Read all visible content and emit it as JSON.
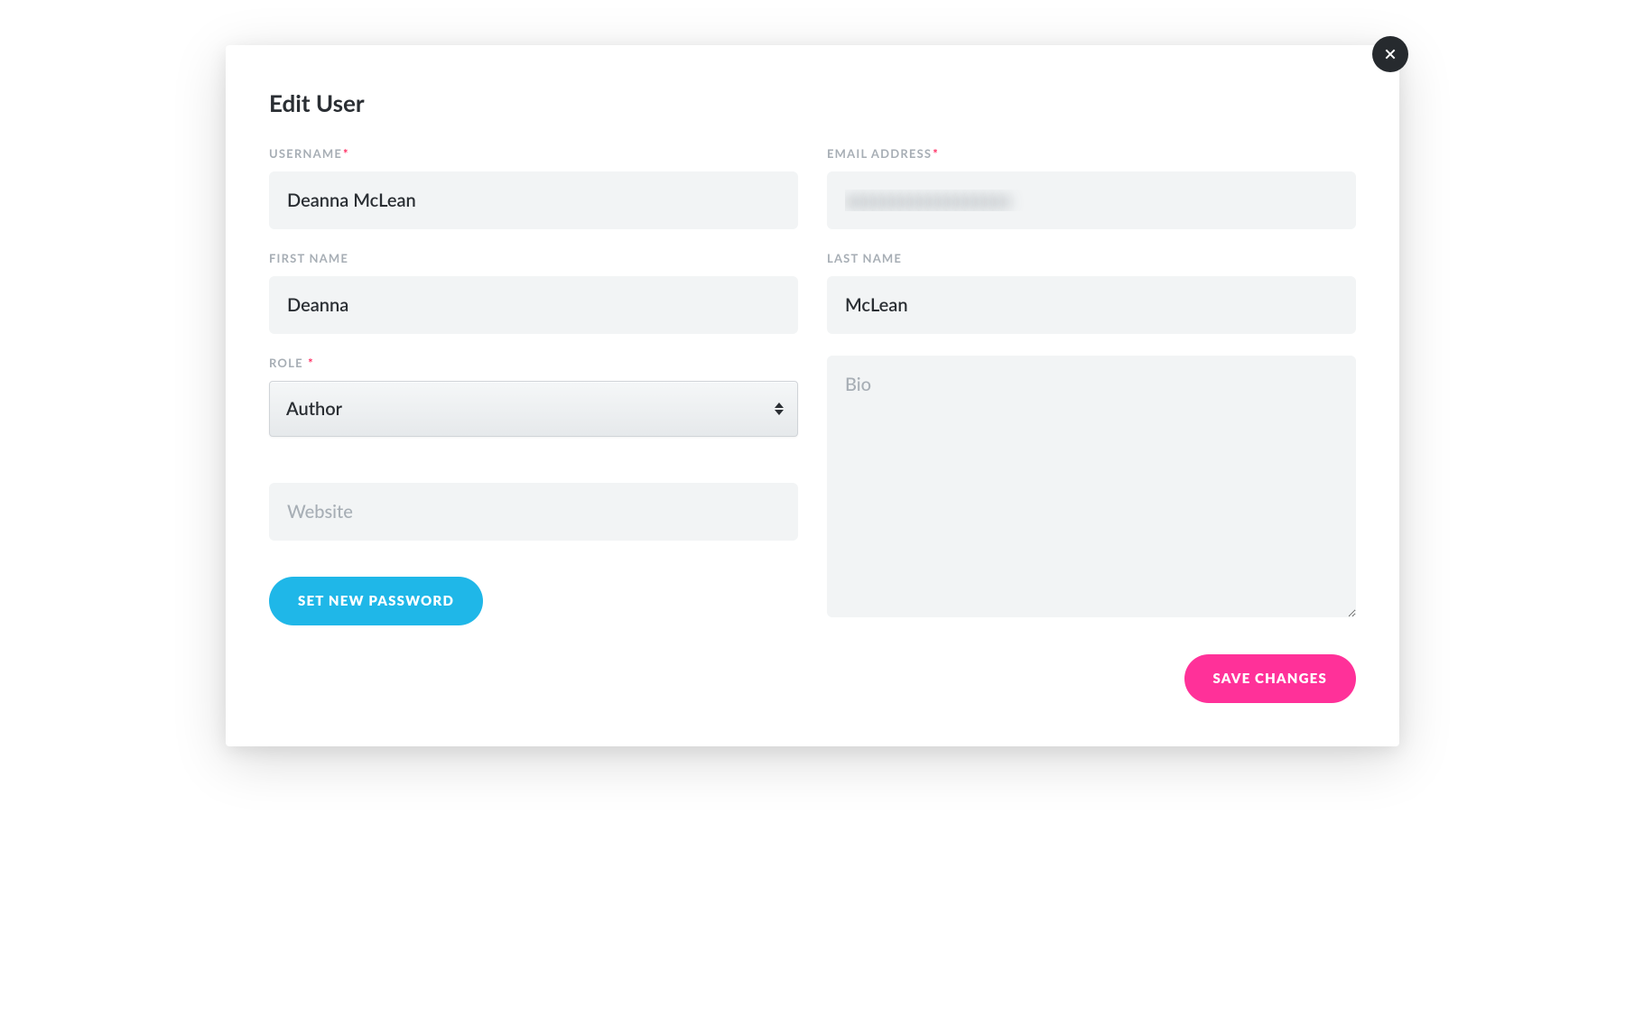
{
  "modal": {
    "title": "Edit User"
  },
  "labels": {
    "username": "USERNAME",
    "email": "EMAIL ADDRESS",
    "firstName": "FIRST NAME",
    "lastName": "LAST NAME",
    "role": "ROLE "
  },
  "values": {
    "username": "Deanna McLean",
    "email": "xxxxxxxxxxxxxxxxxx",
    "firstName": "Deanna",
    "lastName": "McLean",
    "role": "Author",
    "bio": "",
    "website": ""
  },
  "placeholders": {
    "bio": "Bio",
    "website": "Website"
  },
  "buttons": {
    "setPassword": "SET NEW PASSWORD",
    "save": "SAVE CHANGES"
  },
  "roleOptions": [
    "Author"
  ]
}
